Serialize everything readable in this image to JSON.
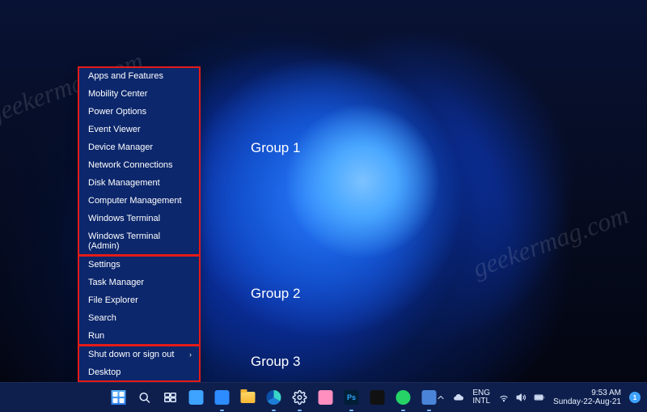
{
  "watermark": "geekermag.com",
  "context_menu": {
    "groups": [
      {
        "label": "Group 1",
        "items": [
          {
            "label": "Apps and Features",
            "submenu": false
          },
          {
            "label": "Mobility Center",
            "submenu": false
          },
          {
            "label": "Power Options",
            "submenu": false
          },
          {
            "label": "Event Viewer",
            "submenu": false
          },
          {
            "label": "Device Manager",
            "submenu": false
          },
          {
            "label": "Network Connections",
            "submenu": false
          },
          {
            "label": "Disk Management",
            "submenu": false
          },
          {
            "label": "Computer Management",
            "submenu": false
          },
          {
            "label": "Windows Terminal",
            "submenu": false
          },
          {
            "label": "Windows Terminal (Admin)",
            "submenu": false
          }
        ]
      },
      {
        "label": "Group 2",
        "items": [
          {
            "label": "Settings",
            "submenu": false
          },
          {
            "label": "Task Manager",
            "submenu": false
          },
          {
            "label": "File Explorer",
            "submenu": false
          },
          {
            "label": "Search",
            "submenu": false
          },
          {
            "label": "Run",
            "submenu": false
          }
        ]
      },
      {
        "label": "Group 3",
        "items": [
          {
            "label": "Shut down or sign out",
            "submenu": true
          },
          {
            "label": "Desktop",
            "submenu": false
          }
        ]
      }
    ]
  },
  "taskbar": {
    "pinned": [
      {
        "name": "start-button",
        "icon": "start-icon",
        "active": false
      },
      {
        "name": "search-button",
        "icon": "search-icon",
        "active": false
      },
      {
        "name": "task-view-button",
        "icon": "taskview-icon",
        "active": false
      },
      {
        "name": "widgets-button",
        "icon": "widgets-icon",
        "active": false
      },
      {
        "name": "zoom-app",
        "icon": "zoom-icon",
        "active": true
      },
      {
        "name": "file-explorer-app",
        "icon": "folder-icon",
        "active": false
      },
      {
        "name": "edge-app",
        "icon": "edge-icon",
        "active": true
      },
      {
        "name": "settings-app",
        "icon": "gear-icon",
        "active": true
      },
      {
        "name": "paint-app",
        "icon": "paint-icon",
        "active": false
      },
      {
        "name": "photoshop-app",
        "icon": "photoshop-icon",
        "active": true
      },
      {
        "name": "terminal-app",
        "icon": "terminal-icon",
        "active": false
      },
      {
        "name": "whatsapp-app",
        "icon": "whatsapp-icon",
        "active": true
      },
      {
        "name": "maps-app",
        "icon": "maps-icon",
        "active": true
      }
    ],
    "tray_icons": [
      "chevron-up-icon",
      "onedrive-icon"
    ],
    "language": {
      "line1": "ENG",
      "line2": "INTL"
    },
    "status_icons": [
      "wifi-icon",
      "volume-icon",
      "battery-icon"
    ],
    "clock": {
      "time": "9:53 AM",
      "date": "Sunday-22-Aug-21"
    },
    "notifications": "1"
  }
}
